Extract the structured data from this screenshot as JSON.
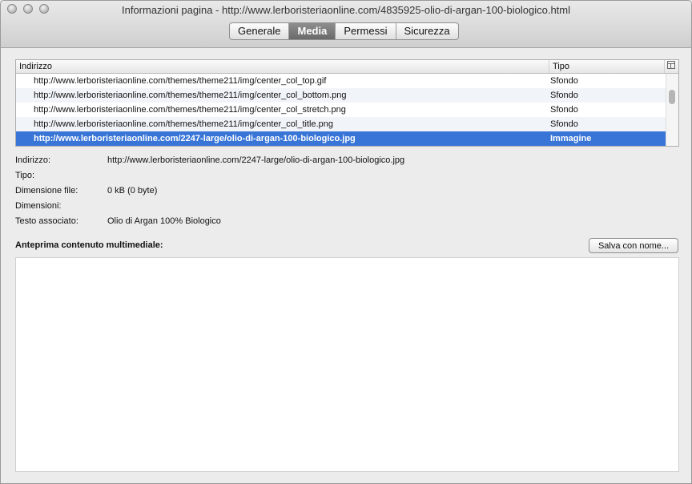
{
  "window": {
    "title": "Informazioni pagina - http://www.lerboristeriaonline.com/4835925-olio-di-argan-100-biologico.html"
  },
  "tabs": [
    {
      "label": "Generale",
      "active": false
    },
    {
      "label": "Media",
      "active": true
    },
    {
      "label": "Permessi",
      "active": false
    },
    {
      "label": "Sicurezza",
      "active": false
    }
  ],
  "list": {
    "columns": {
      "address": "Indirizzo",
      "type": "Tipo"
    },
    "rows": [
      {
        "address": "http://www.lerboristeriaonline.com/themes/theme211/img/center_col_top.gif",
        "type": "Sfondo"
      },
      {
        "address": "http://www.lerboristeriaonline.com/themes/theme211/img/center_col_bottom.png",
        "type": "Sfondo"
      },
      {
        "address": "http://www.lerboristeriaonline.com/themes/theme211/img/center_col_stretch.png",
        "type": "Sfondo"
      },
      {
        "address": "http://www.lerboristeriaonline.com/themes/theme211/img/center_col_title.png",
        "type": "Sfondo"
      },
      {
        "address": "http://www.lerboristeriaonline.com/2247-large/olio-di-argan-100-biologico.jpg",
        "type": "Immagine",
        "selected": true
      }
    ]
  },
  "details": {
    "address_label": "Indirizzo:",
    "address_value": "http://www.lerboristeriaonline.com/2247-large/olio-di-argan-100-biologico.jpg",
    "type_label": "Tipo:",
    "type_value": "",
    "filesize_label": "Dimensione file:",
    "filesize_value": "0 kB (0 byte)",
    "dimensions_label": "Dimensioni:",
    "dimensions_value": "",
    "alt_label": "Testo associato:",
    "alt_value": "Olio di Argan 100% Biologico"
  },
  "preview": {
    "label": "Anteprima contenuto multimediale:",
    "save_label": "Salva con nome..."
  },
  "icons": {
    "traffic_lights": [
      "close-icon",
      "minimize-icon",
      "zoom-icon"
    ],
    "column_picker": "column-picker-icon"
  }
}
